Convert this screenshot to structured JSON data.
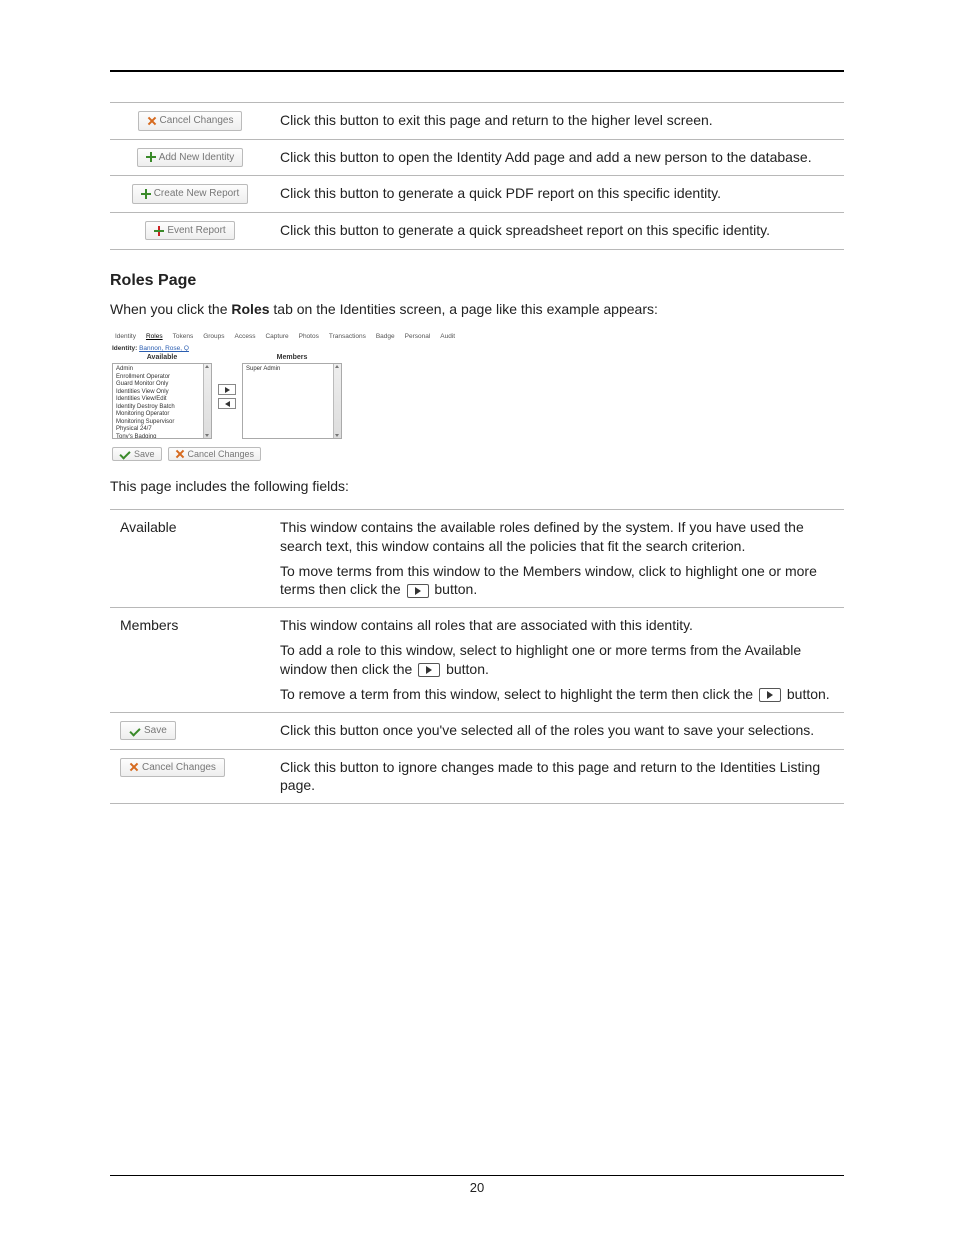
{
  "table1": {
    "rows": [
      {
        "btn": "Cancel Changes",
        "icon": "x",
        "desc": "Click this button to exit this page and return to the higher level screen."
      },
      {
        "btn": "Add New Identity",
        "icon": "plus-green",
        "desc": "Click this button to open the Identity Add page and add a new person to the database."
      },
      {
        "btn": "Create New Report",
        "icon": "plus-green",
        "desc": "Click this button to generate a quick PDF report on this specific identity."
      },
      {
        "btn": "Event Report",
        "icon": "plus-multi",
        "desc": "Click this button to generate a quick spreadsheet report on this specific identity."
      }
    ]
  },
  "section": {
    "heading": "Roles Page",
    "intro_pre": "When you click the ",
    "intro_bold": "Roles",
    "intro_post": " tab on the Identities screen, a page like this example appears:",
    "after_shot": "This page includes the following fields:"
  },
  "shot": {
    "tabs": [
      "Identity",
      "Roles",
      "Tokens",
      "Groups",
      "Access",
      "Capture",
      "Photos",
      "Transactions",
      "Badge",
      "Personal",
      "Audit"
    ],
    "active_tab_index": 1,
    "identity_label": "Identity:",
    "identity_name": "Bannon, Rose, Q",
    "available_header": "Available",
    "members_header": "Members",
    "available_items": [
      "Admin",
      "Enrollment Operator",
      "Guard Monitor Only",
      "Identities View Only",
      "Identities View/Edit",
      "Identity Destroy Batch",
      "Monitoring Operator",
      "Monitoring Supervisor",
      "Physical 24/7",
      "Tony's Badging"
    ],
    "members_items": [
      "Super Admin"
    ],
    "save_btn": "Save",
    "cancel_btn": "Cancel Changes"
  },
  "table2": {
    "rows": [
      {
        "label": "Available",
        "type": "text",
        "p1": "This window contains the available roles defined by the system. If you have used the search text, this window contains all the policies that fit the search criterion.",
        "p2_pre": "To move terms from this window to the Members window, click to highlight one or more terms then click the ",
        "p2_post": " button."
      },
      {
        "label": "Members",
        "type": "text",
        "p1": "This window contains all roles that are associated with this identity.",
        "p2_pre": "To add a role to this window, select to highlight one or more terms from the Available window then click the ",
        "p2_post": " button.",
        "p3_pre": "To remove a term from this window, select to highlight the term then click the ",
        "p3_post": " button."
      },
      {
        "label_btn": "Save",
        "type": "save",
        "p1": "Click this button once you've selected all of the roles you want to save your selections."
      },
      {
        "label_btn": "Cancel Changes",
        "type": "cancel",
        "p1": "Click this button to ignore changes made to this page and return to the Identities Listing page."
      }
    ]
  },
  "page_number": "20"
}
